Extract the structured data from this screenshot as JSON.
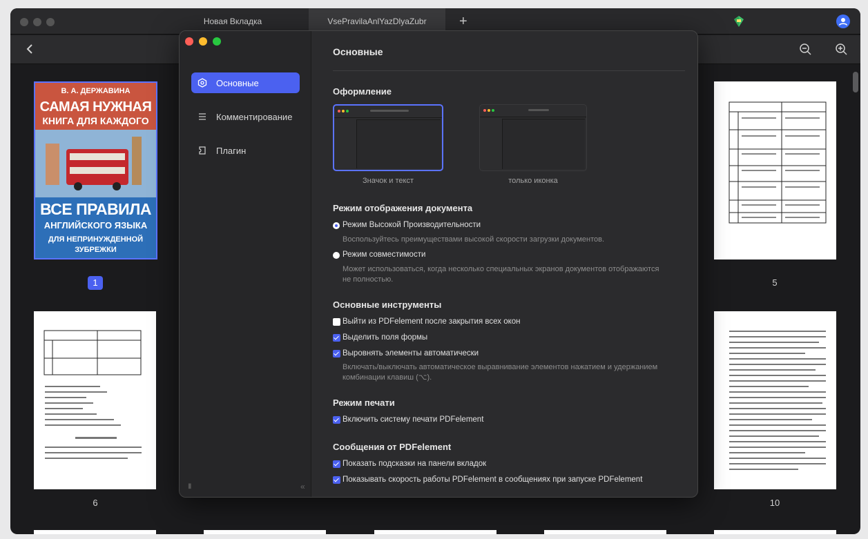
{
  "tabs": [
    {
      "label": "Новая Вкладка",
      "active": false
    },
    {
      "label": "VsePravilaAnlYazDlyaZubr",
      "active": true
    }
  ],
  "tab_plus": "+",
  "thumbnails": [
    {
      "page": "1",
      "selected": true
    },
    {
      "page": "5",
      "selected": false
    },
    {
      "page": "6",
      "selected": false
    },
    {
      "page": "10",
      "selected": false
    }
  ],
  "cover": {
    "author": "В. А. ДЕРЖАВИНА",
    "title_line1": "САМАЯ НУЖНАЯ",
    "title_line2": "КНИГА ДЛЯ КАЖДОГО",
    "title_line3": "ВСЕ ПРАВИЛА",
    "title_line4": "АНГЛИЙСКОГО ЯЗЫКА",
    "title_line5": "ДЛЯ НЕПРИНУЖДЕННОЙ",
    "title_line6": "ЗУБРЕЖКИ"
  },
  "sidebar": {
    "items": [
      {
        "label": "Основные",
        "active": true
      },
      {
        "label": "Комментирование",
        "active": false
      },
      {
        "label": "Плагин",
        "active": false
      }
    ],
    "collapse_glyph": "«"
  },
  "content": {
    "title": "Основные",
    "appearance": {
      "heading": "Оформление",
      "option_icon_text": "Значок и текст",
      "option_icon_only": "только иконка"
    },
    "display_mode": {
      "heading": "Режим отображения документа",
      "high_perf_label": "Режим Высокой Производительности",
      "high_perf_desc": "Воспользуйтесь преимуществами высокой скорости загрузки документов.",
      "compat_label": "Режим совместимости",
      "compat_desc": "Может использоваться, когда несколько специальных экранов документов отображаются не полностью."
    },
    "tools": {
      "heading": "Основные инструменты",
      "quit_label": "Выйти из PDFelement после закрытия всех окон",
      "highlight_label": "Выделить поля формы",
      "align_label": "Выровнять элементы автоматически",
      "align_desc": "Включать/выключать автоматическое выравнивание элементов нажатием и удержанием комбинации клавиш (⌥)."
    },
    "print": {
      "heading": "Режим печати",
      "enable_label": "Включить систему печати PDFelement"
    },
    "messages": {
      "heading": "Сообщения от PDFelement",
      "tips_label": "Показать подсказки на панели вкладок",
      "speed_label": "Показывать скорость работы PDFelement в сообщениях при запуске PDFelement"
    }
  },
  "colors": {
    "accent": "#4b61f0",
    "dialog_bg": "#2b2b2d",
    "sidebar_bg": "#262628"
  }
}
